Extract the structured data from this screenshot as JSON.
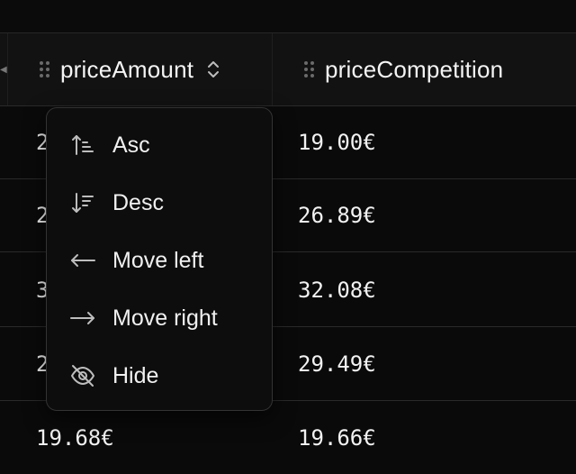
{
  "columns": [
    {
      "label": "priceAmount"
    },
    {
      "label": "priceCompetition"
    }
  ],
  "rows": [
    {
      "priceAmount": "2",
      "priceCompetition": "19.00€"
    },
    {
      "priceAmount": "2",
      "priceCompetition": "26.89€"
    },
    {
      "priceAmount": "3",
      "priceCompetition": "32.08€"
    },
    {
      "priceAmount": "2",
      "priceCompetition": "29.49€"
    },
    {
      "priceAmount": "19.68€",
      "priceCompetition": "19.66€"
    }
  ],
  "menu": {
    "items": [
      {
        "label": "Asc",
        "icon": "sort-ascending-icon"
      },
      {
        "label": "Desc",
        "icon": "sort-descending-icon"
      },
      {
        "label": "Move left",
        "icon": "arrow-left-icon"
      },
      {
        "label": "Move right",
        "icon": "arrow-right-icon"
      },
      {
        "label": "Hide",
        "icon": "eye-off-icon"
      }
    ]
  },
  "colors": {
    "background": "#0a0a0a",
    "header_background": "#121212",
    "menu_background": "#0d0d0d",
    "border": "#2a2a2a",
    "text": "#f2f2f2"
  }
}
